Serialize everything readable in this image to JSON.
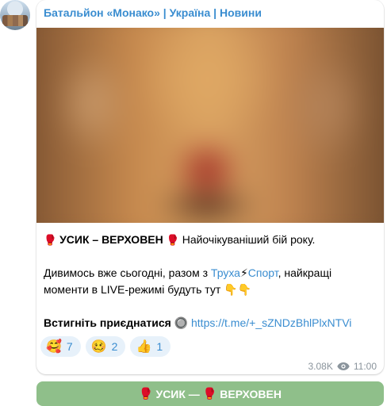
{
  "channel": {
    "name": "Батальйон «Монако» | Україна | Новини"
  },
  "post": {
    "headline_icon": "🥊",
    "headline": "УСИК – ВЕРХОВЕН",
    "headline_tail": " Найочікуваніший бій року.",
    "line2_start": "Дивимось вже сьогодні, разом з ",
    "link_truha": "Труха",
    "link_bolt": "⚡",
    "link_sport": "Спорт",
    "line2_end": ", найкращі моменти в LIVE-режимі будуть тут 👇👇",
    "join_label": "Встигніть приєднатися",
    "join_icon": "🔘",
    "join_url": "https://t.me/+_sZNDzBhlPlxNTVi"
  },
  "reactions": [
    {
      "emoji": "🥰",
      "count": "7"
    },
    {
      "emoji": "🥴",
      "count": "2"
    },
    {
      "emoji": "👍",
      "count": "1"
    }
  ],
  "meta": {
    "views": "3.08K",
    "time": "11:00"
  },
  "button": {
    "icon": "🥊",
    "label": "УСИК — ",
    "label2": "ВЕРХОВЕН"
  },
  "colors": {
    "link": "#3a8dd0",
    "button_bg": "#8fbf8a",
    "reaction_bg": "#e7f1fa"
  }
}
